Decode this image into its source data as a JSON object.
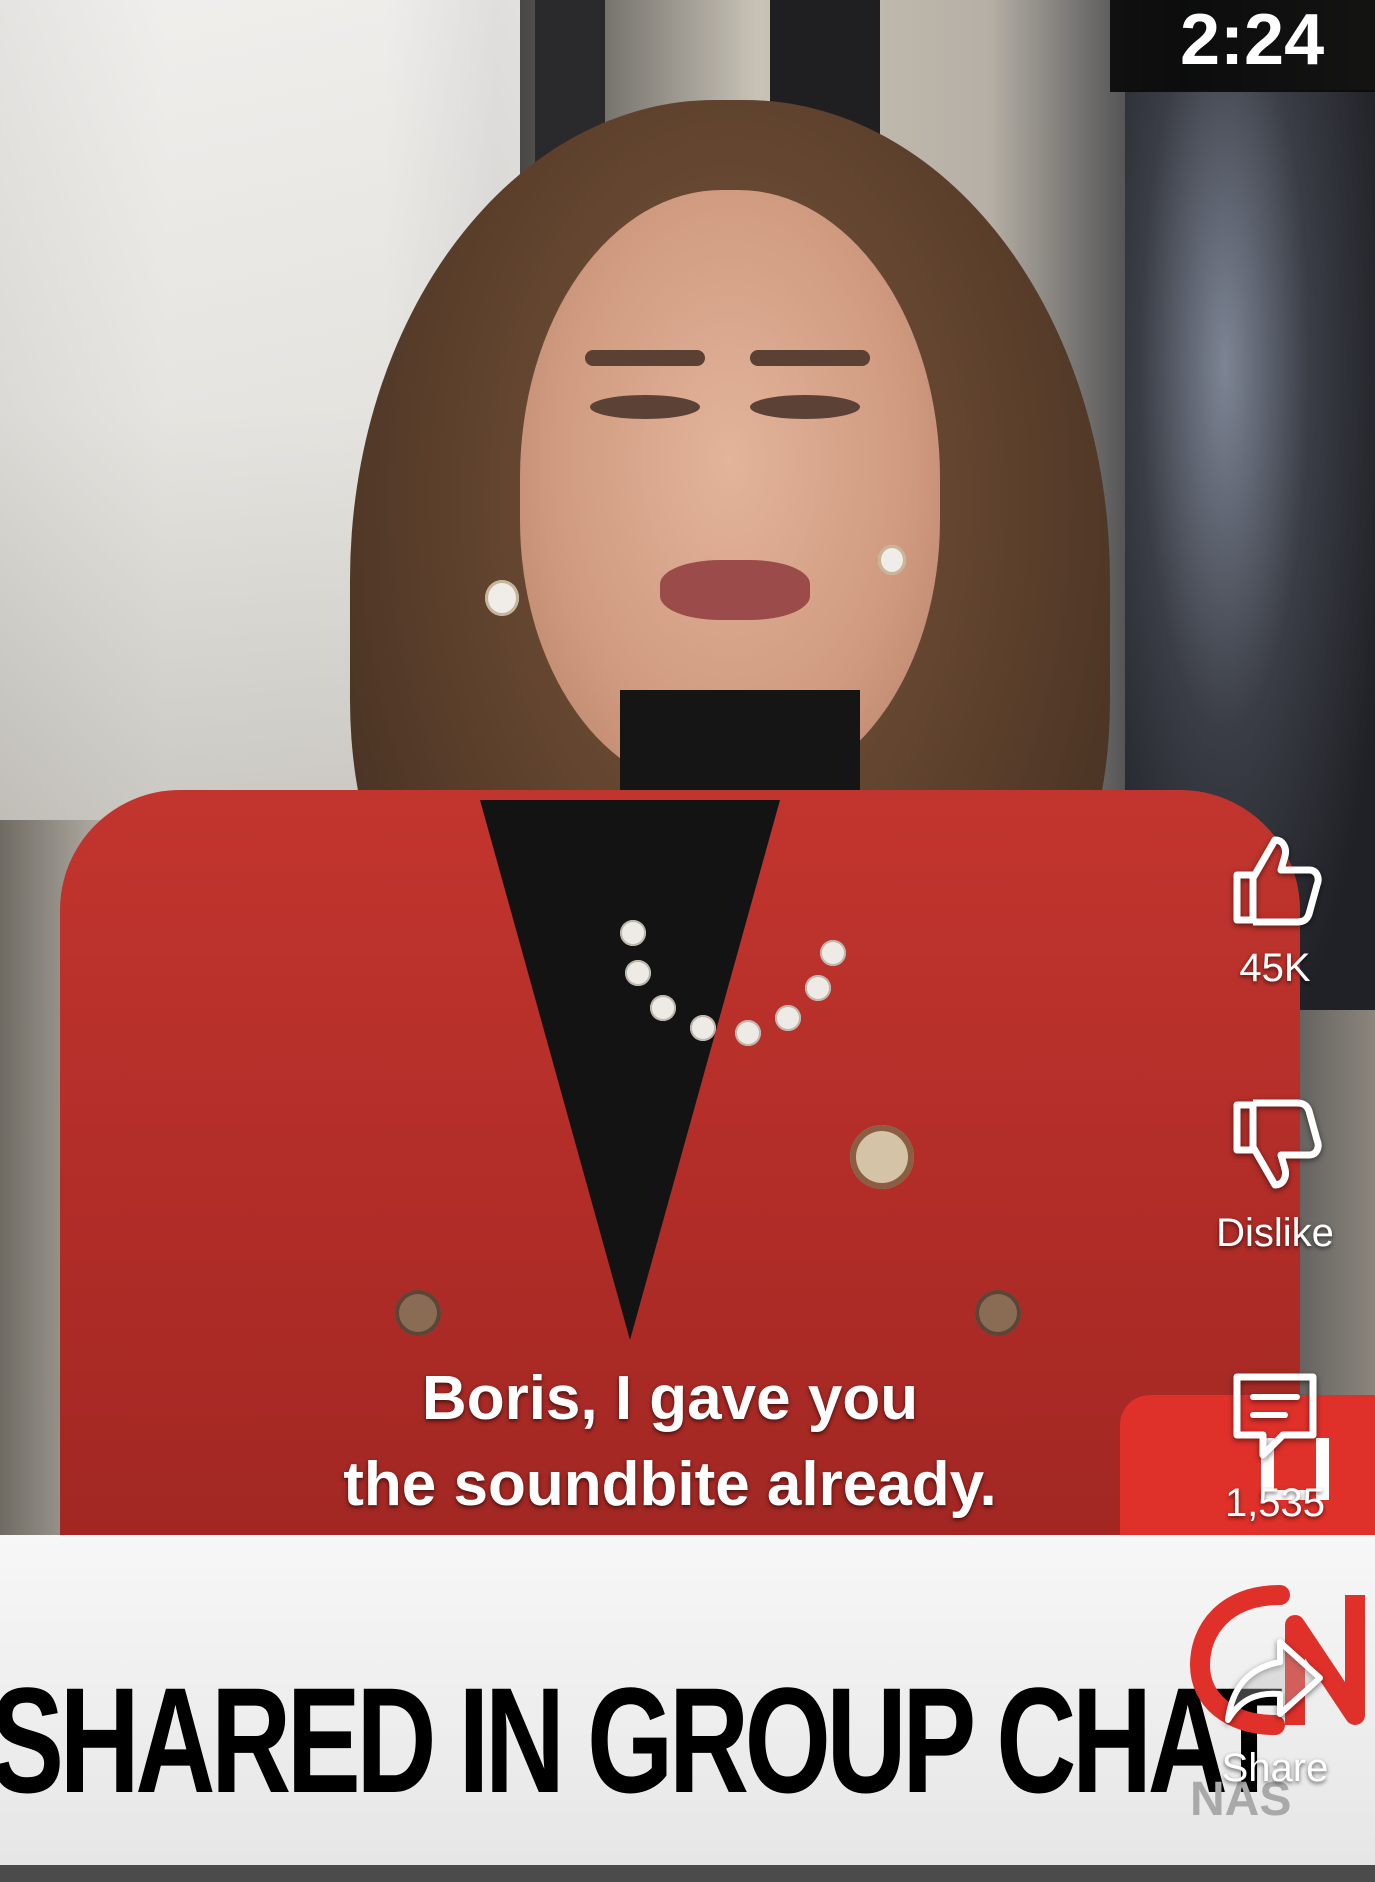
{
  "video": {
    "clock": "2:24",
    "caption_lines": [
      "Boris, I gave you",
      "the soundbite already."
    ],
    "live_tag": "LI",
    "banner_text": "SHARED IN GROUP CHAT",
    "logo_text": "CNN",
    "network_code": "NAS"
  },
  "actions": {
    "like": {
      "icon": "thumbs-up-icon",
      "label": "45K"
    },
    "dislike": {
      "icon": "thumbs-down-icon",
      "label": "Dislike"
    },
    "comments": {
      "icon": "comment-icon",
      "label": "1,535"
    },
    "share": {
      "icon": "share-icon",
      "label": "Share"
    }
  },
  "colors": {
    "jacket_red": "#b22d28",
    "banner_bg": "#efefef",
    "live_red": "#e0302a"
  }
}
